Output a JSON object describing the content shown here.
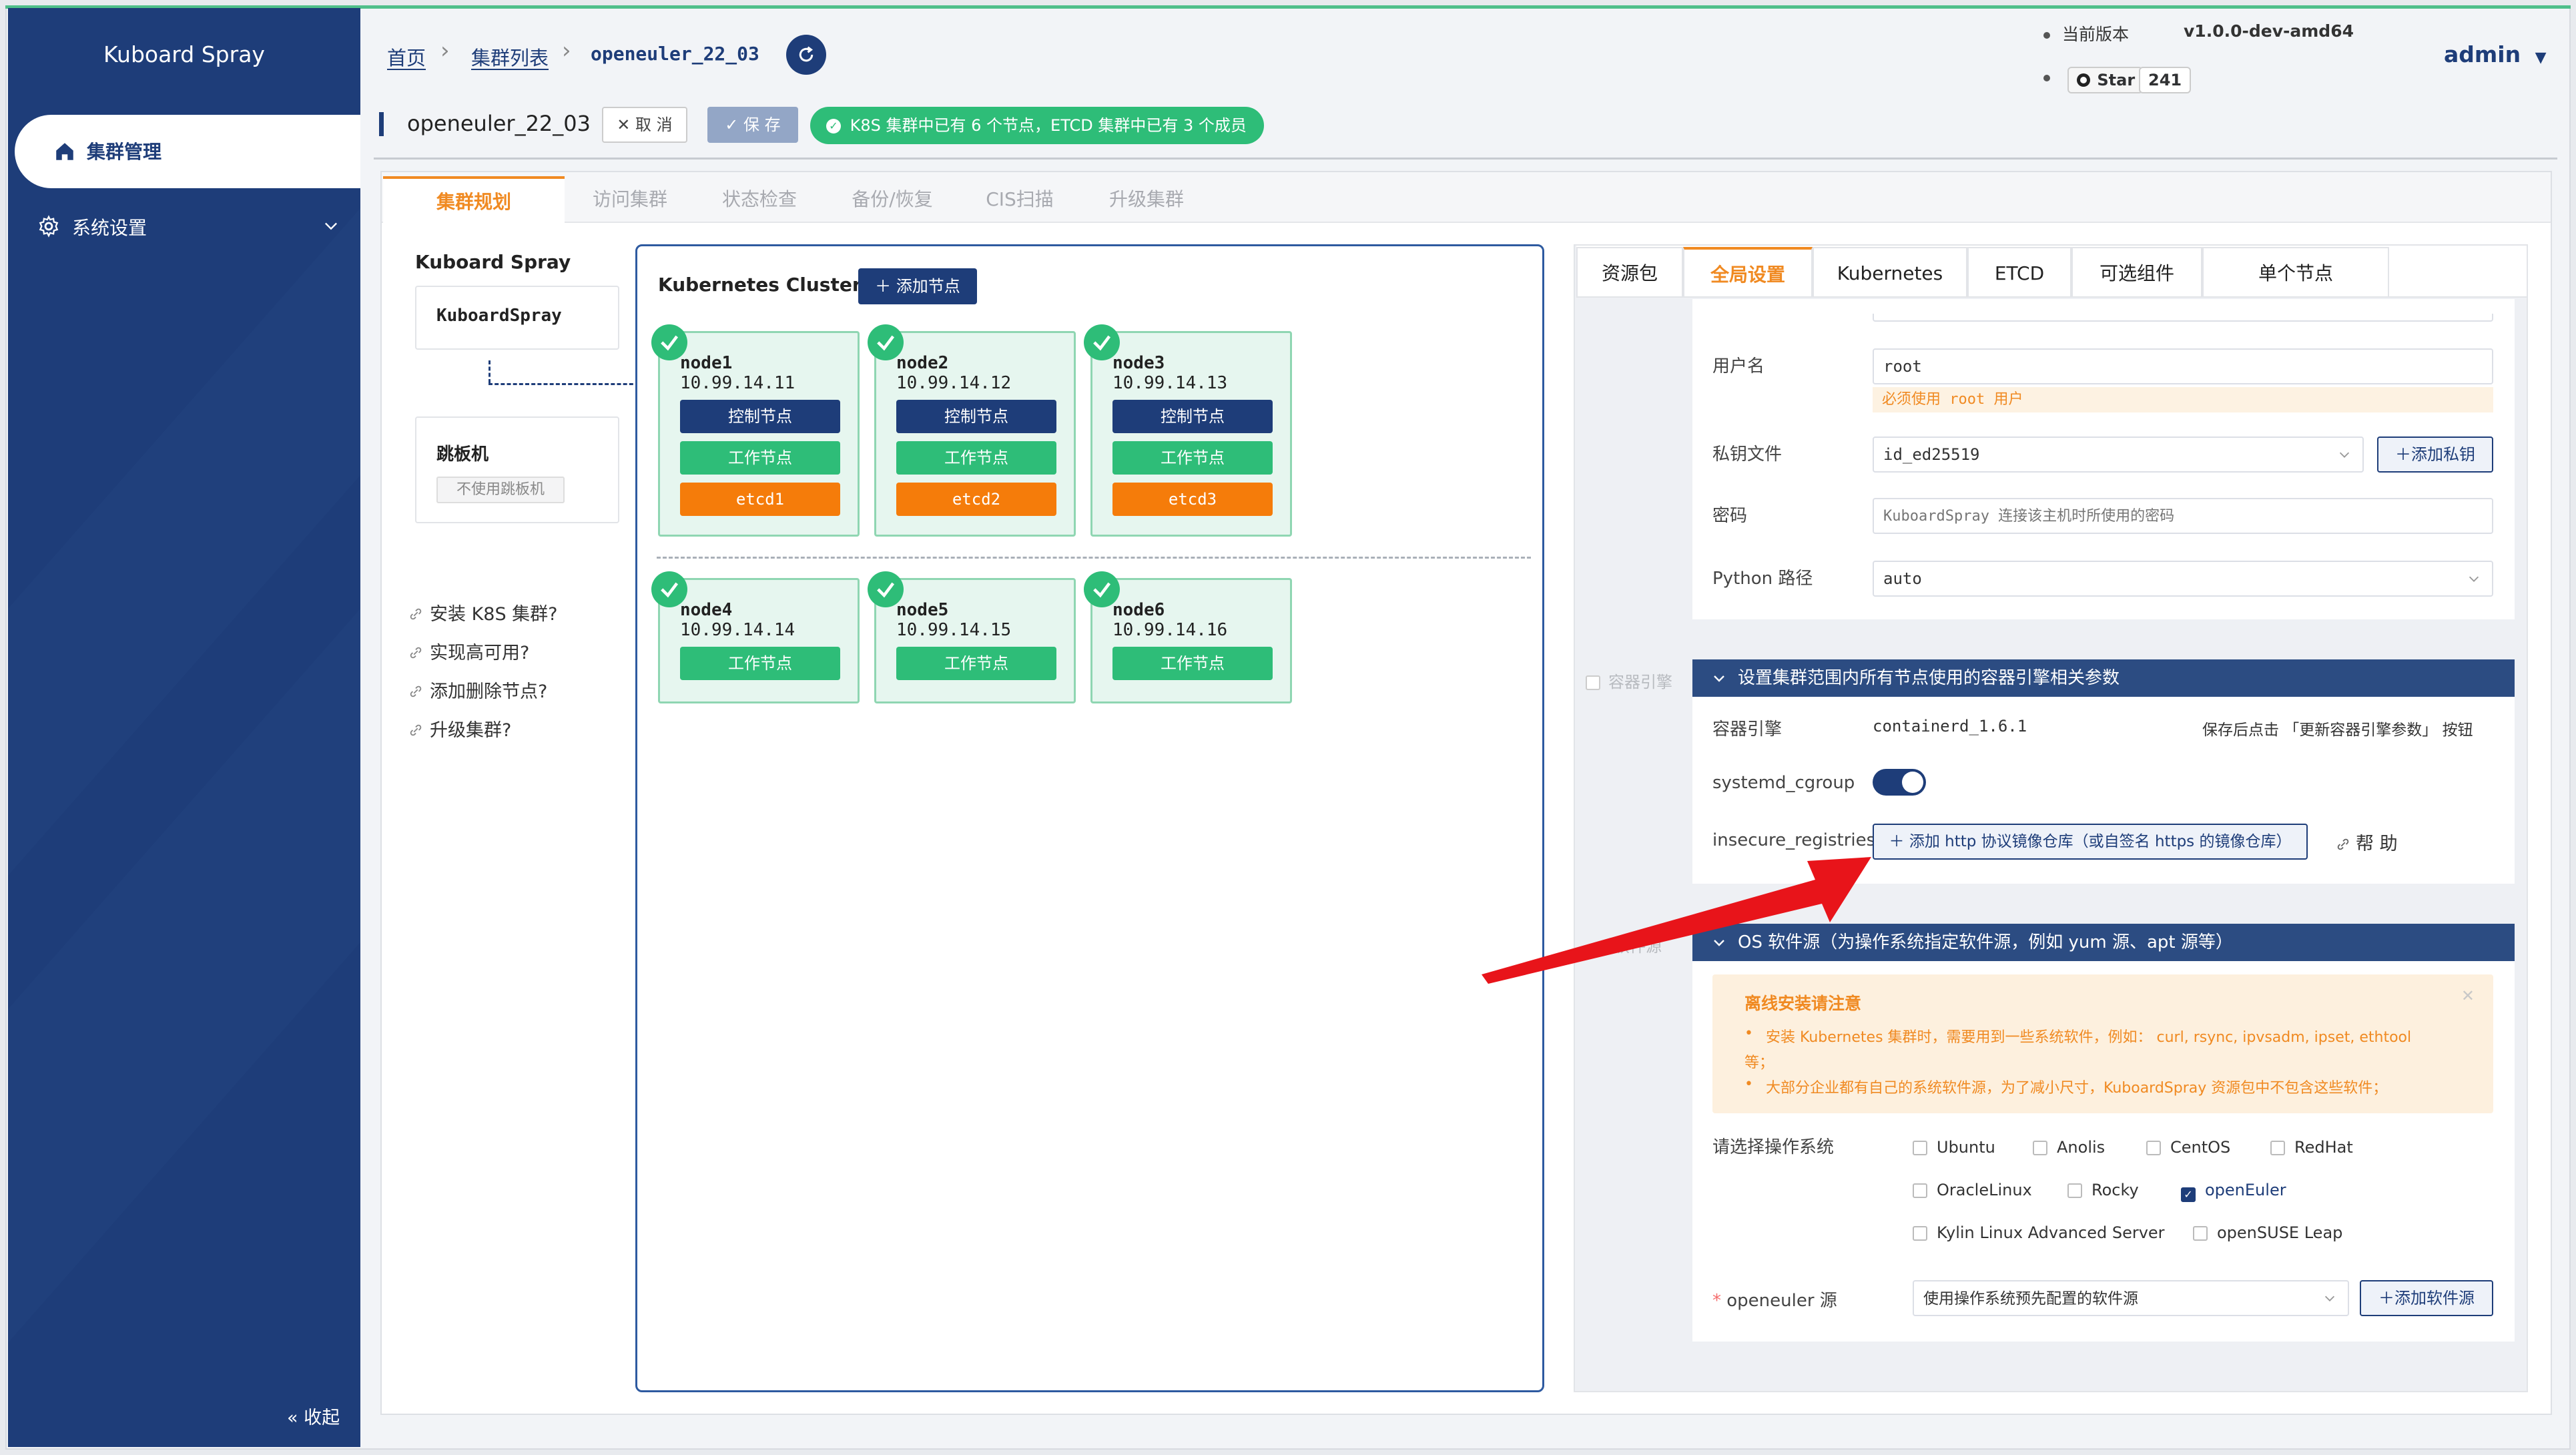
{
  "app": {
    "title": "Kuboard Spray"
  },
  "sidebar": {
    "items": [
      {
        "label": "集群管理",
        "icon": "home-icon",
        "active": true
      },
      {
        "label": "系统设置",
        "icon": "gear-icon",
        "active": false
      }
    ],
    "collapse_label": "收起"
  },
  "breadcrumb": {
    "home": "首页",
    "list": "集群列表",
    "current": "openeuler_22_03"
  },
  "header": {
    "version_label": "当前版本",
    "version_value": "v1.0.0-dev-amd64",
    "star_label": "Star",
    "star_count": "241",
    "user": "admin"
  },
  "cluster": {
    "name": "openeuler_22_03",
    "cancel_label": "取 消",
    "save_label": "保 存",
    "status_text": "K8S 集群中已有 6 个节点，ETCD 集群中已有 3 个成员"
  },
  "main_tabs": [
    {
      "label": "集群规划",
      "active": true
    },
    {
      "label": "访问集群",
      "active": false
    },
    {
      "label": "状态检查",
      "active": false
    },
    {
      "label": "备份/恢复",
      "active": false
    },
    {
      "label": "CIS扫描",
      "active": false
    },
    {
      "label": "升级集群",
      "active": false
    }
  ],
  "left": {
    "heading": "Kuboard Spray",
    "box_label": "KuboardSpray",
    "jump_title": "跳板机",
    "jump_tag": "不使用跳板机",
    "help_links": [
      "安装 K8S 集群?",
      "实现高可用?",
      "添加删除节点?",
      "升级集群?"
    ]
  },
  "k8s": {
    "title": "Kubernetes Cluster",
    "add_node_label": "添加节点",
    "role_labels": {
      "control": "控制节点",
      "worker": "工作节点"
    },
    "nodes_row1": [
      {
        "name": "node1",
        "ip": "10.99.14.11",
        "etcd": "etcd1"
      },
      {
        "name": "node2",
        "ip": "10.99.14.12",
        "etcd": "etcd2"
      },
      {
        "name": "node3",
        "ip": "10.99.14.13",
        "etcd": "etcd3"
      }
    ],
    "nodes_row2": [
      {
        "name": "node4",
        "ip": "10.99.14.14"
      },
      {
        "name": "node5",
        "ip": "10.99.14.15"
      },
      {
        "name": "node6",
        "ip": "10.99.14.16"
      }
    ]
  },
  "right_tabs": [
    {
      "label": "资源包",
      "active": false
    },
    {
      "label": "全局设置",
      "active": true
    },
    {
      "label": "Kubernetes",
      "active": false
    },
    {
      "label": "ETCD",
      "active": false
    },
    {
      "label": "可选组件",
      "active": false
    },
    {
      "label": "单个节点",
      "active": false
    }
  ],
  "ssh": {
    "username_label": "用户名",
    "username_value": "root",
    "username_warning": "必须使用 root 用户",
    "key_label": "私钥文件",
    "key_value": "id_ed25519",
    "add_key_label": "添加私钥",
    "password_label": "密码",
    "password_placeholder": "KuboardSpray 连接该主机时所使用的密码",
    "python_label": "Python 路径",
    "python_value": "auto"
  },
  "container": {
    "side_label": "容器引擎",
    "section_title": "设置集群范围内所有节点使用的容器引擎相关参数",
    "engine_label": "容器引擎",
    "engine_value": "containerd_1.6.1",
    "engine_hint": "保存后点击 「更新容器引擎参数」 按钮",
    "cgroup_label": "systemd_cgroup",
    "cgroup_on": true,
    "registries_label": "insecure_registries",
    "add_registry_label": "添加 http 协议镜像仓库（或自签名 https 的镜像仓库）",
    "help_label": "帮 助"
  },
  "os_repo": {
    "side_label": "软件源",
    "section_title": "OS 软件源（为操作系统指定软件源，例如 yum 源、apt 源等）",
    "alert_title": "离线安装请注意",
    "alert_item1": "安装 Kubernetes 集群时，需要用到一些系统软件，例如： curl, rsync, ipvsadm, ipset, ethtool",
    "alert_item1_cont": "等；",
    "alert_item2": "大部分企业都有自己的系统软件源，为了减小尺寸，KuboardSpray 资源包中不包含这些软件；",
    "os_select_label": "请选择操作系统",
    "os_options": [
      {
        "label": "Ubuntu",
        "checked": false
      },
      {
        "label": "Anolis",
        "checked": false
      },
      {
        "label": "CentOS",
        "checked": false
      },
      {
        "label": "RedHat",
        "checked": false
      },
      {
        "label": "OracleLinux",
        "checked": false
      },
      {
        "label": "Rocky",
        "checked": false
      },
      {
        "label": "openEuler",
        "checked": true
      },
      {
        "label": "Kylin Linux Advanced Server",
        "checked": false
      },
      {
        "label": "openSUSE Leap",
        "checked": false
      }
    ],
    "source_label": "openeuler 源",
    "source_value": "使用操作系统预先配置的软件源",
    "add_source_label": "添加软件源"
  },
  "colors": {
    "sidebar": "#1e3d79",
    "accent": "#f08a22",
    "success": "#2ebd78",
    "etcd": "#f57c0a",
    "arrow": "#e8141a"
  }
}
